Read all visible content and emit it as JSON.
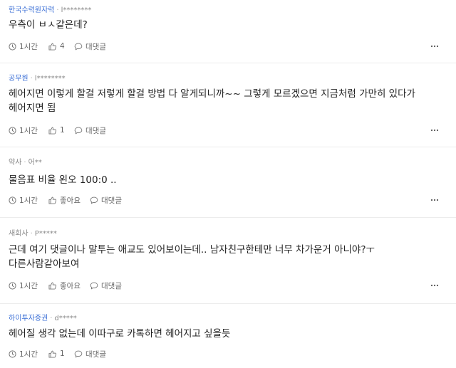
{
  "comments": [
    {
      "company": "한국수력원자력",
      "user": "l********",
      "text": "우측이 ㅂㅅ같은데?",
      "time": "1시간",
      "likes": "4",
      "reply_label": "대댓글"
    },
    {
      "company": "공무원",
      "user": "l********",
      "text": "헤어지면 이렇게 할걸 저렇게 할걸 방법 다 알게되니까~~ 그렇게 모르겠으면 지금처럼 가만히 있다가 헤어지면 됨",
      "time": "1시간",
      "likes": "1",
      "reply_label": "대댓글"
    },
    {
      "company": "약사",
      "user": "어**",
      "text": "물음표 비율 왼오 100:0 ..",
      "time": "1시간",
      "likes": "좋아요",
      "reply_label": "대댓글"
    },
    {
      "company": "새회사",
      "user": "P*****",
      "text": "근데 여기 댓글이나 말투는 애교도 있어보이는데.. 남자친구한테만 너무 차가운거 아니야?ㅜ 다른사람같아보여",
      "time": "1시간",
      "likes": "좋아요",
      "reply_label": "대댓글"
    },
    {
      "company": "하이투자증권",
      "user": "d*****",
      "text": "헤어질 생각 없는데 이따구로 카톡하면 헤어지고 싶을듯",
      "time": "1시간",
      "likes": "1",
      "reply_label": "대댓글"
    }
  ],
  "icons": {
    "time": "clock-icon",
    "like": "thumbs-up-icon",
    "reply": "speech-bubble-icon",
    "more": "more-dots-icon"
  },
  "colors": {
    "company_link": "#3b6fd6",
    "meta": "#888888",
    "text": "#222222",
    "divider": "#ececec"
  }
}
